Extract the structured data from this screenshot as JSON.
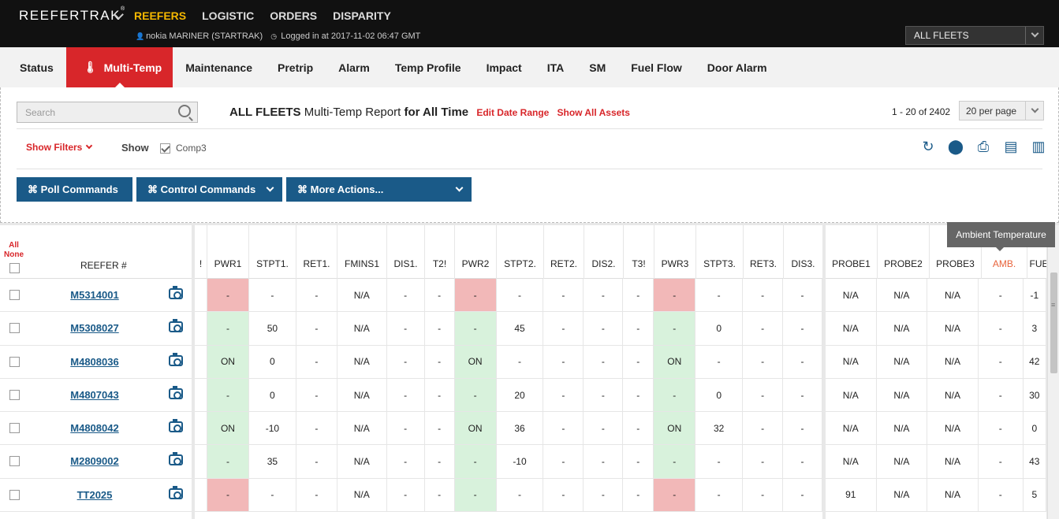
{
  "brand": {
    "name": "REEFERTRAK",
    "mark": "®"
  },
  "topnav": [
    "REEFERS",
    "LOGISTIC",
    "ORDERS",
    "DISPARITY"
  ],
  "user": {
    "name": "nokia MARINER (STARTRAK)",
    "login": "Logged in at 2017-11-02 06:47 GMT"
  },
  "fleet_select": {
    "value": "ALL FLEETS"
  },
  "tabs": [
    "Status",
    "Multi-Temp",
    "Maintenance",
    "Pretrip",
    "Alarm",
    "Temp Profile",
    "Impact",
    "ITA",
    "SM",
    "Fuel Flow",
    "Door Alarm"
  ],
  "search": {
    "placeholder": "Search"
  },
  "report": {
    "fleet": "ALL FLEETS",
    "mid": "Multi-Temp Report",
    "range": "for All Time",
    "edit_date": "Edit Date Range",
    "show_all": "Show All Assets"
  },
  "paging": {
    "text": "1 - 20 of 2402",
    "per_page": "20 per page"
  },
  "filters": {
    "show_filters": "Show Filters",
    "show": "Show",
    "comp3": "Comp3"
  },
  "actions": {
    "poll": "⌘ Poll Commands",
    "control": "⌘ Control Commands",
    "more": "⌘ More Actions..."
  },
  "grid": {
    "select_all": "All",
    "select_none": "None",
    "reefer_header": "REEFER #",
    "mid_headers": [
      "!",
      "PWR1",
      "STPT1.",
      "RET1.",
      "FMINS1",
      "DIS1.",
      "T2!",
      "PWR2",
      "STPT2.",
      "RET2.",
      "DIS2.",
      "T3!",
      "PWR3",
      "STPT3.",
      "RET3.",
      "DIS3."
    ],
    "right_headers": [
      "PROBE1",
      "PROBE2",
      "PROBE3",
      "AMB.",
      "FUE"
    ],
    "rows": [
      {
        "id": "M5314001",
        "mid": [
          "",
          "-",
          "-",
          "-",
          "N/A",
          "-",
          "-",
          "-",
          "-",
          "-",
          "-",
          "-",
          "-",
          "-",
          "-",
          "-"
        ],
        "right": [
          "N/A",
          "N/A",
          "N/A",
          "-",
          "-1"
        ]
      },
      {
        "id": "M5308027",
        "mid": [
          "",
          "-",
          "50",
          "-",
          "N/A",
          "-",
          "-",
          "-",
          "45",
          "-",
          "-",
          "-",
          "-",
          "0",
          "-",
          "-"
        ],
        "right": [
          "N/A",
          "N/A",
          "N/A",
          "-",
          "3"
        ]
      },
      {
        "id": "M4808036",
        "mid": [
          "",
          "ON",
          "0",
          "-",
          "N/A",
          "-",
          "-",
          "ON",
          "-",
          "-",
          "-",
          "-",
          "ON",
          "-",
          "-",
          "-"
        ],
        "right": [
          "N/A",
          "N/A",
          "N/A",
          "-",
          "42"
        ]
      },
      {
        "id": "M4807043",
        "mid": [
          "",
          "-",
          "0",
          "-",
          "N/A",
          "-",
          "-",
          "-",
          "20",
          "-",
          "-",
          "-",
          "-",
          "0",
          "-",
          "-"
        ],
        "right": [
          "N/A",
          "N/A",
          "N/A",
          "-",
          "30"
        ]
      },
      {
        "id": "M4808042",
        "mid": [
          "",
          "ON",
          "-10",
          "-",
          "N/A",
          "-",
          "-",
          "ON",
          "36",
          "-",
          "-",
          "-",
          "ON",
          "32",
          "-",
          "-"
        ],
        "right": [
          "N/A",
          "N/A",
          "N/A",
          "-",
          "0"
        ]
      },
      {
        "id": "M2809002",
        "mid": [
          "",
          "-",
          "35",
          "-",
          "N/A",
          "-",
          "-",
          "-",
          "-10",
          "-",
          "-",
          "-",
          "-",
          "-",
          "-",
          "-"
        ],
        "right": [
          "N/A",
          "N/A",
          "N/A",
          "-",
          "43"
        ]
      },
      {
        "id": "TT2025",
        "mid": [
          "",
          "-",
          "-",
          "-",
          "N/A",
          "-",
          "-",
          "-",
          "-",
          "-",
          "-",
          "-",
          "-",
          "-",
          "-",
          "-"
        ],
        "right": [
          "91",
          "N/A",
          "N/A",
          "-",
          "5"
        ]
      }
    ],
    "pwr_status": [
      [
        "red",
        "red",
        "red"
      ],
      [
        "green",
        "green",
        "green"
      ],
      [
        "green",
        "green",
        "green"
      ],
      [
        "green",
        "green",
        "green"
      ],
      [
        "green",
        "green",
        "green"
      ],
      [
        "green",
        "green",
        "green"
      ],
      [
        "red",
        "green",
        "red"
      ]
    ]
  },
  "tooltip": "Ambient Temperature",
  "colors": {
    "accent_red": "#d8262a",
    "nav_yellow": "#f5b800",
    "primary_blue": "#1a5a88",
    "alarm_red": "#f2b8b8",
    "ok_green": "#d8f2dc"
  }
}
